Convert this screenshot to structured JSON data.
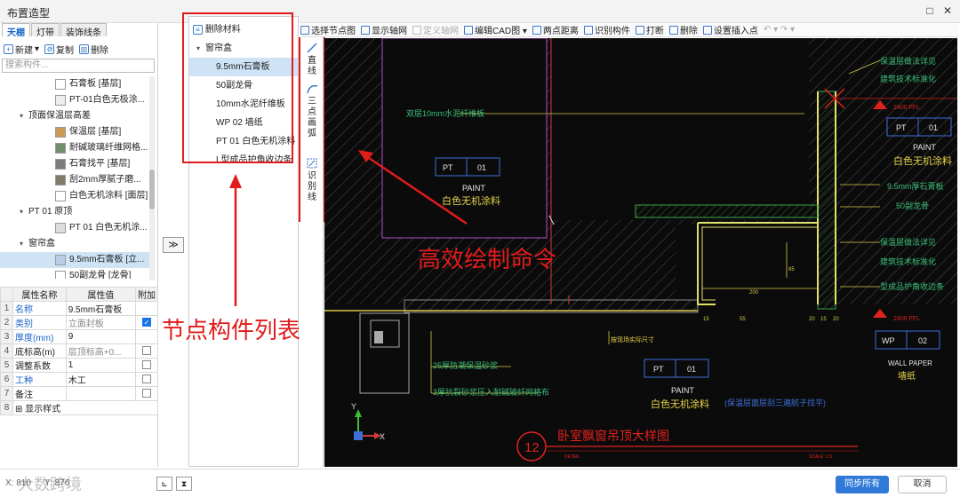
{
  "window": {
    "title": "布置造型",
    "restore_icon": "□",
    "close_icon": "✕"
  },
  "left_tabs": [
    "天棚",
    "灯带",
    "装饰线条"
  ],
  "left_toolbar": {
    "new": "新建",
    "copy": "复制",
    "delete": "删除"
  },
  "search": {
    "placeholder": "搜索构件..."
  },
  "tree": [
    {
      "label": "石膏板 [基层]",
      "level": 2,
      "color": "#ffffff"
    },
    {
      "label": "PT-01白色无极涂...",
      "level": 2,
      "color": "#eeeeee"
    },
    {
      "label": "顶面保温层高差",
      "level": 1,
      "color": ""
    },
    {
      "label": "保温层 [基层]",
      "level": 2,
      "color": "#c99b57"
    },
    {
      "label": "耐碱玻璃纤维网格...",
      "level": 2,
      "color": "#6f8f6a"
    },
    {
      "label": "石膏找平 [基层]",
      "level": 2,
      "color": "#7d7d7d"
    },
    {
      "label": "刮2mm厚腻子磨...",
      "level": 2,
      "color": "#807a66"
    },
    {
      "label": "白色无机涂料 [面层]",
      "level": 2,
      "color": "#ffffff"
    },
    {
      "label": "PT 01 原顶",
      "level": 1,
      "color": ""
    },
    {
      "label": "PT 01 白色无机涂...",
      "level": 2,
      "color": "#dddddd"
    },
    {
      "label": "窗帘盒",
      "level": 1,
      "color": ""
    },
    {
      "label": "9.5mm石膏板 [立...",
      "level": 2,
      "color": "#b9cde6",
      "selected": true
    },
    {
      "label": "50副龙骨 [龙骨]",
      "level": 2,
      "color": "#ffffff"
    }
  ],
  "props": {
    "headers": [
      "属性名称",
      "属性值",
      "附加"
    ],
    "rows": [
      {
        "n": "1",
        "name": "名称",
        "value": "9.5mm石膏板",
        "name_blue": true,
        "check": ""
      },
      {
        "n": "2",
        "name": "类别",
        "value": "立面封板",
        "name_blue": true,
        "value_gray": true,
        "check": "on"
      },
      {
        "n": "3",
        "name": "厚度(mm)",
        "value": "9",
        "name_blue": true,
        "check": ""
      },
      {
        "n": "4",
        "name": "底标高(m)",
        "value": "层顶标高+0...",
        "value_gray": true,
        "check": "off"
      },
      {
        "n": "5",
        "name": "调整系数",
        "value": "1",
        "check": "off"
      },
      {
        "n": "6",
        "name": "工种",
        "value": "木工",
        "name_blue": true,
        "check": "off"
      },
      {
        "n": "7",
        "name": "备注",
        "value": "",
        "check": "off"
      },
      {
        "n": "8",
        "name": "显示样式",
        "value": "",
        "check": ""
      }
    ]
  },
  "transfer_button": "≫",
  "material_list": {
    "delete_label": "删除材料",
    "group": "窗帘盒",
    "items": [
      "9.5mm石膏板",
      "50副龙骨",
      "10mm水泥纤维板",
      "WP 02 墙纸",
      "PT 01 白色无机涂料",
      "L型成品护角收边条"
    ]
  },
  "draw_tools": [
    {
      "icon": "line-icon",
      "label": "直线"
    },
    {
      "icon": "arc-icon",
      "label": "三点画弧"
    },
    {
      "icon": "identify-line-icon",
      "label": "识别线"
    }
  ],
  "toolbar": [
    {
      "label": "选择节点图",
      "disabled": false
    },
    {
      "label": "显示轴网",
      "disabled": false
    },
    {
      "label": "定义轴网",
      "disabled": true
    },
    {
      "label": "编辑CAD图 ▾",
      "disabled": false
    },
    {
      "label": "两点距离",
      "disabled": false
    },
    {
      "label": "识别构件",
      "disabled": false
    },
    {
      "label": "打断",
      "disabled": false
    },
    {
      "label": "删除",
      "disabled": false
    },
    {
      "label": "设置插入点",
      "disabled": false
    }
  ],
  "annotations": {
    "left": "节点构件列表",
    "right": "高效绘制命令"
  },
  "cad": {
    "labels_left": [
      "双层10mm水泥纤维板",
      "25厚防潮保温砂浆",
      "3厚抗裂砂浆压入耐碱玻纤网格布"
    ],
    "labels_right": [
      "保温层做法详见",
      "建筑技术标准化",
      "PT",
      "PAINT",
      "白色无机涂料",
      "9.5mm厚石膏板",
      "50副龙骨",
      "保温层做法详见",
      "建筑技术标准化",
      "型成品护角收边条",
      "WP",
      "WALL PAPER",
      "墙纸"
    ],
    "tag_pt": "PT",
    "tag_num": "01",
    "tag_wp_num": "02",
    "paint": "PAINT",
    "paint_cn": "白色无机涂料",
    "bottom_note": "(保温层面层刮三遍腻子找平)",
    "title_num": "12",
    "title": "卧室飘窗吊顶大样图",
    "detail": "DETAIL",
    "scale": "SCALE: 1:5",
    "dims": [
      "200",
      "85",
      "15",
      "55",
      "20",
      "15",
      "20"
    ],
    "sub_note": "按现场实际尺寸",
    "elev": "2400 FFL",
    "y_axis": "Y",
    "x_axis": "X"
  },
  "bottom": {
    "coord_x": "X: 810",
    "coord_y": "Y: 876",
    "sync_all": "同步所有",
    "cancel": "取消",
    "watermark": "大数跨境"
  }
}
